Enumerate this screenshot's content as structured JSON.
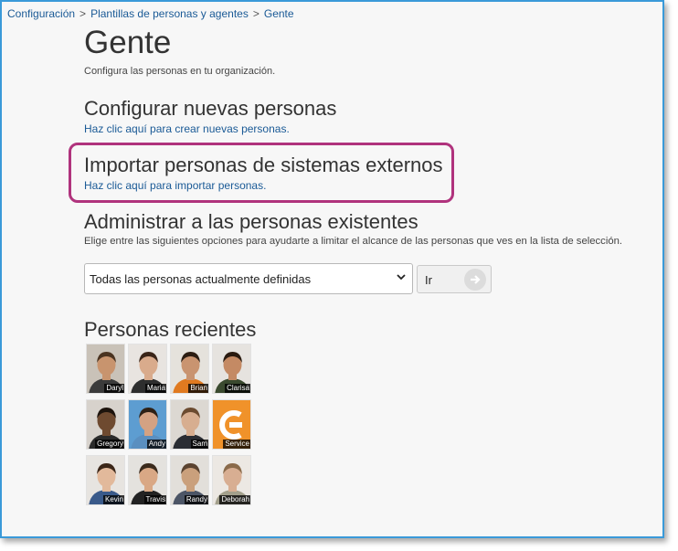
{
  "breadcrumb": {
    "item1": "Configuración",
    "item2": "Plantillas de personas y agentes",
    "current": "Gente",
    "separator": ">"
  },
  "page": {
    "title": "Gente",
    "subtitle": "Configura las personas en tu organización."
  },
  "sections": {
    "new_people": {
      "title": "Configurar nuevas personas",
      "link": "Haz clic aquí para crear nuevas personas."
    },
    "import": {
      "title": "Importar personas de sistemas externos",
      "link": "Haz clic aquí para importar personas."
    },
    "manage": {
      "title": "Administrar a las personas existentes",
      "description": "Elige entre las siguientes opciones para ayudarte a limitar el alcance de las personas que ves en la lista de selección.",
      "select_value": "Todas las personas actualmente definidas",
      "go_label": "Ir"
    },
    "recent": {
      "title": "Personas recientes",
      "people": [
        {
          "name": "Daryl",
          "bg": "#c9c2b8",
          "shirt": "#3b3b3b",
          "skin": "#c8946e",
          "hair": "#4a3320"
        },
        {
          "name": "Maria",
          "bg": "#e8e4e0",
          "shirt": "#2e2e2e",
          "skin": "#d9ab8c",
          "hair": "#3a2518"
        },
        {
          "name": "Brian",
          "bg": "#e5e2dc",
          "shirt": "#e07a20",
          "skin": "#c99470",
          "hair": "#2c1d12"
        },
        {
          "name": "Clarisa",
          "bg": "#e6e3df",
          "shirt": "#3a4a2f",
          "skin": "#c48a64",
          "hair": "#2a1b10"
        },
        {
          "name": "Gregory",
          "bg": "#d7d2cc",
          "shirt": "#2b2b2b",
          "skin": "#6e4a30",
          "hair": "#1d140d"
        },
        {
          "name": "Andy",
          "bg": "#5d9dd1",
          "shirt": "#5a8fc0",
          "skin": "#d4a283",
          "hair": "#2e2116"
        },
        {
          "name": "Sam",
          "bg": "#dcd8d2",
          "shirt": "#2a2d33",
          "skin": "#d7ae90",
          "hair": "#6b4b30"
        },
        {
          "name": "Service",
          "bg": "#f0922a",
          "shirt": "#f0922a",
          "skin": "#ffffff",
          "hair": "#f0922a"
        },
        {
          "name": "Kevin",
          "bg": "#e7e4e0",
          "shirt": "#3a5a8a",
          "skin": "#e2b99b",
          "hair": "#3b2618"
        },
        {
          "name": "Travis",
          "bg": "#e4e2de",
          "shirt": "#222222",
          "skin": "#d9a885",
          "hair": "#3a2a1c"
        },
        {
          "name": "Randy",
          "bg": "#e2dfda",
          "shirt": "#4c5566",
          "skin": "#caa07c",
          "hair": "#5a4330"
        },
        {
          "name": "Deborah",
          "bg": "#ece8e3",
          "shirt": "#a3a08c",
          "skin": "#d8ae92",
          "hair": "#8a6a4a"
        }
      ]
    }
  },
  "colors": {
    "link": "#1a5a96",
    "highlight": "#b0337d",
    "frame_border": "#3a9ad9"
  }
}
